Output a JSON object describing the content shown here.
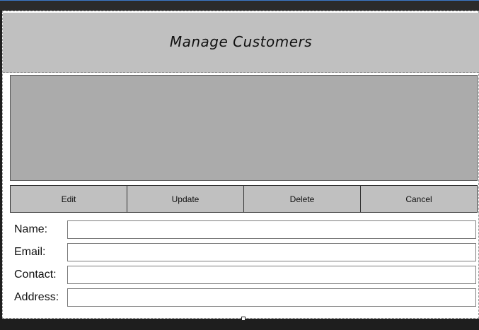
{
  "header": {
    "title": "Manage Customers"
  },
  "actions": {
    "edit": "Edit",
    "update": "Update",
    "delete": "Delete",
    "cancel": "Cancel"
  },
  "fields": {
    "name_label": "Name:",
    "name_value": "",
    "email_label": "Email:",
    "email_value": "",
    "contact_label": "Contact:",
    "contact_value": "",
    "address_label": "Address:",
    "address_value": ""
  }
}
